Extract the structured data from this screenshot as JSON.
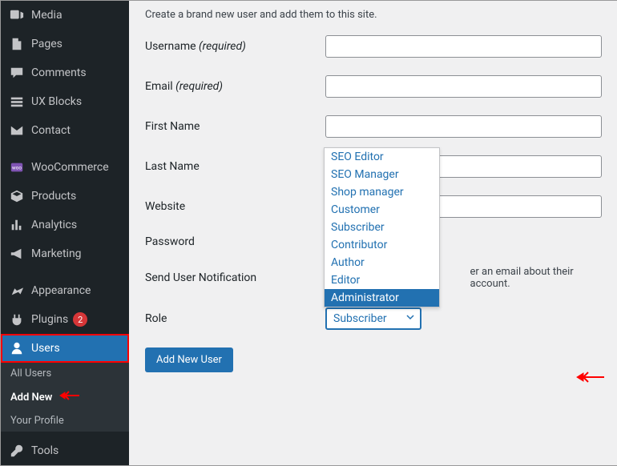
{
  "sidebar": {
    "items": [
      {
        "id": "media",
        "label": "Media"
      },
      {
        "id": "pages",
        "label": "Pages"
      },
      {
        "id": "comments",
        "label": "Comments"
      },
      {
        "id": "ux-blocks",
        "label": "UX Blocks"
      },
      {
        "id": "contact",
        "label": "Contact"
      },
      {
        "id": "woocommerce",
        "label": "WooCommerce"
      },
      {
        "id": "products",
        "label": "Products"
      },
      {
        "id": "analytics",
        "label": "Analytics"
      },
      {
        "id": "marketing",
        "label": "Marketing"
      },
      {
        "id": "appearance",
        "label": "Appearance"
      },
      {
        "id": "plugins",
        "label": "Plugins",
        "badge": "2"
      },
      {
        "id": "users",
        "label": "Users"
      },
      {
        "id": "tools",
        "label": "Tools"
      }
    ],
    "sub_items": [
      {
        "id": "all-users",
        "label": "All Users"
      },
      {
        "id": "add-new",
        "label": "Add New"
      },
      {
        "id": "your-profile",
        "label": "Your Profile"
      }
    ]
  },
  "intro": "Create a brand new user and add them to this site.",
  "form": {
    "username_label": "Username",
    "email_label": "Email",
    "firstname_label": "First Name",
    "lastname_label": "Last Name",
    "website_label": "Website",
    "password_label": "Password",
    "notification_label": "Send User Notification",
    "notification_note": "er an email about their account.",
    "role_label": "Role",
    "required": "(required)"
  },
  "role_select": {
    "value": "Subscriber",
    "options": [
      "SEO Editor",
      "SEO Manager",
      "Shop manager",
      "Customer",
      "Subscriber",
      "Contributor",
      "Author",
      "Editor",
      "Administrator"
    ],
    "highlighted": "Administrator"
  },
  "button": {
    "submit": "Add New User"
  }
}
